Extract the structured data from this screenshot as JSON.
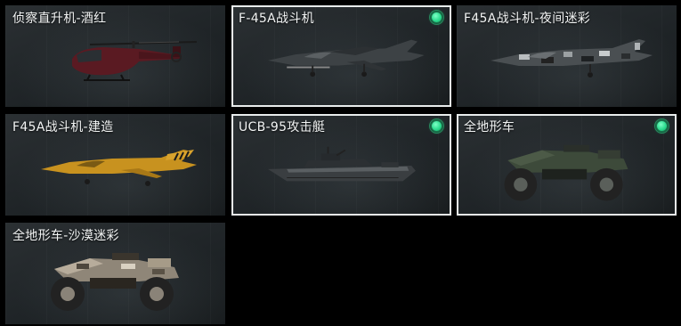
{
  "vehicles": [
    {
      "name": "侦察直升机-酒红",
      "selected": false,
      "owned": false
    },
    {
      "name": "F-45A战斗机",
      "selected": true,
      "owned": true
    },
    {
      "name": "F45A战斗机-夜间迷彩",
      "selected": false,
      "owned": false
    },
    {
      "name": "F45A战斗机-建造",
      "selected": false,
      "owned": false
    },
    {
      "name": "UCB-95攻击艇",
      "selected": true,
      "owned": true
    },
    {
      "name": "全地形车",
      "selected": true,
      "owned": true
    },
    {
      "name": "全地形车-沙漠迷彩",
      "selected": false,
      "owned": false
    }
  ],
  "colors": {
    "selected_border": "#e8ecec",
    "owned_indicator": "#2ddc8f",
    "card_background": "#1f2427",
    "page_background": "#000000"
  }
}
